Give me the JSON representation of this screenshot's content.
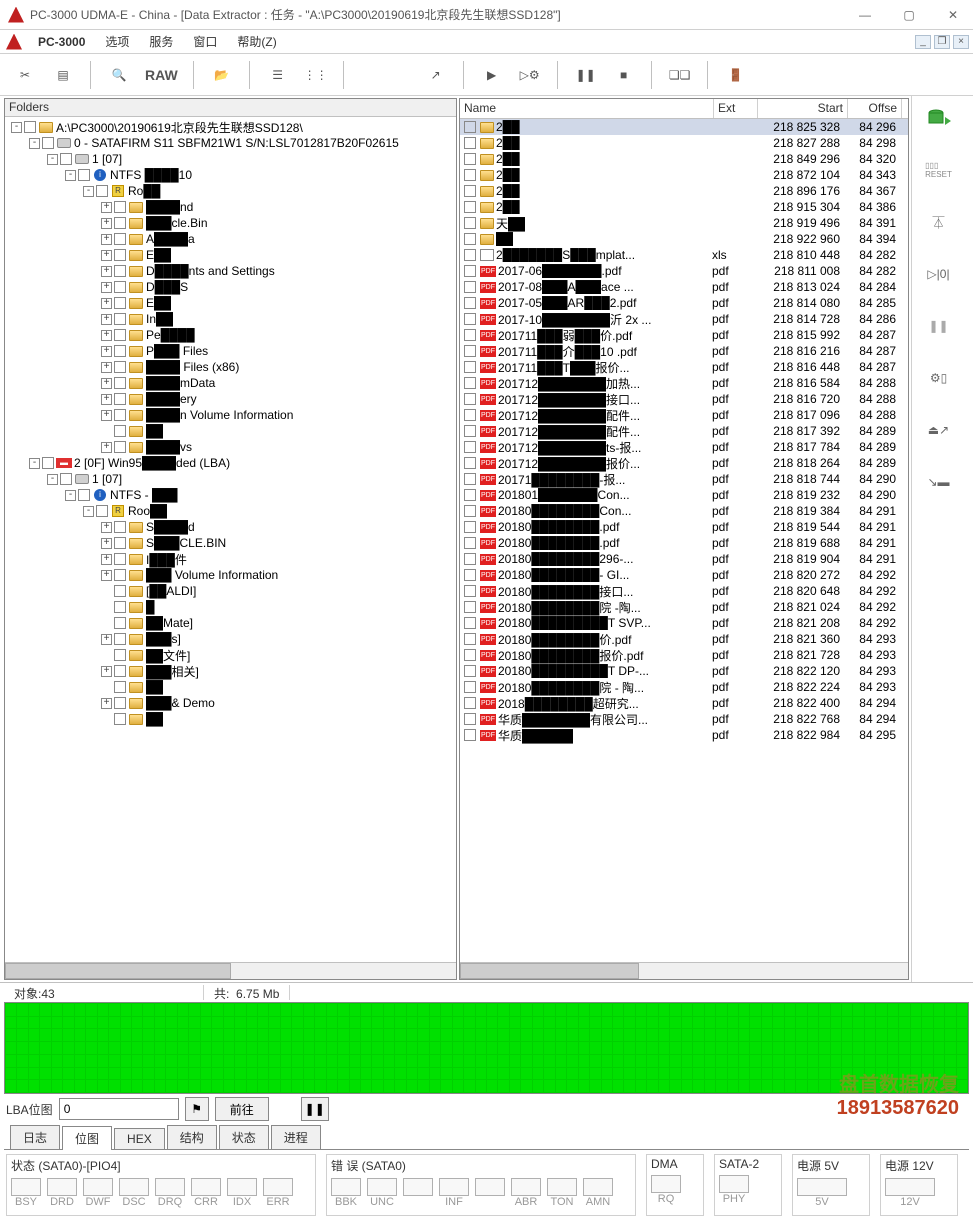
{
  "title": "PC-3000 UDMA-E - China - [Data Extractor : 任务 - \"A:\\PC3000\\20190619北京段先生联想SSD128\"]",
  "menu": {
    "app": "PC-3000",
    "items": [
      "选项",
      "服务",
      "窗口",
      "帮助(Z)"
    ]
  },
  "toolbar": {
    "raw": "RAW"
  },
  "folders_title": "Folders",
  "tree": [
    {
      "indent": 0,
      "exp": "-",
      "cb": true,
      "ico": "folder",
      "label": "A:\\PC3000\\20190619北京段先生联想SSD128\\"
    },
    {
      "indent": 1,
      "exp": "-",
      "cb": true,
      "ico": "disk",
      "label": "0 - SATAFIRM   S11 SBFM21W1 S/N:LSL7012817B20F02615"
    },
    {
      "indent": 2,
      "exp": "-",
      "cb": true,
      "ico": "disk",
      "label": "1 [07]"
    },
    {
      "indent": 3,
      "exp": "-",
      "cb": true,
      "ico": "ntfs",
      "label": "NTFS ████10",
      "blur": true
    },
    {
      "indent": 4,
      "exp": "-",
      "cb": true,
      "ico": "r",
      "label": "Ro██",
      "blur": true
    },
    {
      "indent": 5,
      "exp": "+",
      "cb": true,
      "ico": "folder",
      "label": "████nd",
      "blur": true
    },
    {
      "indent": 5,
      "exp": "+",
      "cb": true,
      "ico": "folder",
      "label": "███cle.Bin",
      "blur": true
    },
    {
      "indent": 5,
      "exp": "+",
      "cb": true,
      "ico": "folder",
      "label": "A████a",
      "blur": true
    },
    {
      "indent": 5,
      "exp": "+",
      "cb": true,
      "ico": "folder",
      "label": "E██",
      "blur": true
    },
    {
      "indent": 5,
      "exp": "+",
      "cb": true,
      "ico": "folder",
      "label": "D████nts and Settings",
      "blur": true
    },
    {
      "indent": 5,
      "exp": "+",
      "cb": true,
      "ico": "folder",
      "label": "D███S",
      "blur": true
    },
    {
      "indent": 5,
      "exp": "+",
      "cb": true,
      "ico": "folder",
      "label": "E██",
      "blur": true
    },
    {
      "indent": 5,
      "exp": "+",
      "cb": true,
      "ico": "folder",
      "label": "In██",
      "blur": true
    },
    {
      "indent": 5,
      "exp": "+",
      "cb": true,
      "ico": "folder",
      "label": "Pe████",
      "blur": true
    },
    {
      "indent": 5,
      "exp": "+",
      "cb": true,
      "ico": "folder",
      "label": "P███ Files",
      "blur": true
    },
    {
      "indent": 5,
      "exp": "+",
      "cb": true,
      "ico": "folder",
      "label": "████ Files (x86)",
      "blur": true
    },
    {
      "indent": 5,
      "exp": "+",
      "cb": true,
      "ico": "folder",
      "label": "████mData",
      "blur": true
    },
    {
      "indent": 5,
      "exp": "+",
      "cb": true,
      "ico": "folder",
      "label": "████ery",
      "blur": true
    },
    {
      "indent": 5,
      "exp": "+",
      "cb": true,
      "ico": "folder",
      "label": "████n Volume Information",
      "blur": true
    },
    {
      "indent": 5,
      "exp": "",
      "cb": true,
      "ico": "folder",
      "label": "██",
      "blur": true
    },
    {
      "indent": 5,
      "exp": "+",
      "cb": true,
      "ico": "folder",
      "label": "████vs",
      "blur": true
    },
    {
      "indent": 1,
      "exp": "-",
      "cb": true,
      "ico": "red",
      "label": "2 [0F] Win95████ded  (LBA)",
      "blur": true
    },
    {
      "indent": 2,
      "exp": "-",
      "cb": true,
      "ico": "disk",
      "label": "1 [07]"
    },
    {
      "indent": 3,
      "exp": "-",
      "cb": true,
      "ico": "ntfs",
      "label": "NTFS - ███",
      "blur": true
    },
    {
      "indent": 4,
      "exp": "-",
      "cb": true,
      "ico": "r",
      "label": "Roo██",
      "blur": true
    },
    {
      "indent": 5,
      "exp": "+",
      "cb": true,
      "ico": "folder",
      "label": "S████d",
      "blur": true
    },
    {
      "indent": 5,
      "exp": "+",
      "cb": true,
      "ico": "folder",
      "label": "S███CLE.BIN",
      "blur": true
    },
    {
      "indent": 5,
      "exp": "+",
      "cb": true,
      "ico": "folder",
      "label": "I███件",
      "blur": true
    },
    {
      "indent": 5,
      "exp": "+",
      "cb": true,
      "ico": "folder",
      "label": "███ Volume Information",
      "blur": true
    },
    {
      "indent": 5,
      "exp": "",
      "cb": true,
      "ico": "folder",
      "label": "[██ALDI]",
      "blur": true
    },
    {
      "indent": 5,
      "exp": "",
      "cb": true,
      "ico": "folder",
      "label": "█",
      "blur": true
    },
    {
      "indent": 5,
      "exp": "",
      "cb": true,
      "ico": "folder",
      "label": "██Mate]",
      "blur": true
    },
    {
      "indent": 5,
      "exp": "+",
      "cb": true,
      "ico": "folder",
      "label": "███s]",
      "blur": true
    },
    {
      "indent": 5,
      "exp": "",
      "cb": true,
      "ico": "folder",
      "label": "██文件]",
      "blur": true
    },
    {
      "indent": 5,
      "exp": "+",
      "cb": true,
      "ico": "folder",
      "label": "███相关]",
      "blur": true
    },
    {
      "indent": 5,
      "exp": "",
      "cb": true,
      "ico": "folder",
      "label": "██",
      "blur": true
    },
    {
      "indent": 5,
      "exp": "+",
      "cb": true,
      "ico": "folder",
      "label": "███& Demo",
      "blur": true
    },
    {
      "indent": 5,
      "exp": "",
      "cb": true,
      "ico": "folder",
      "label": "██",
      "blur": true
    }
  ],
  "file_header": {
    "name": "Name",
    "ext": "Ext",
    "start": "Start",
    "offse": "Offse"
  },
  "files": [
    {
      "ico": "folder",
      "name": "2██",
      "ext": "",
      "start": "218 825 328",
      "offse": "84 296",
      "sel": true
    },
    {
      "ico": "folder",
      "name": "2██",
      "ext": "",
      "start": "218 827 288",
      "offse": "84 298"
    },
    {
      "ico": "folder",
      "name": "2██",
      "ext": "",
      "start": "218 849 296",
      "offse": "84 320"
    },
    {
      "ico": "folder",
      "name": "2██",
      "ext": "",
      "start": "218 872 104",
      "offse": "84 343"
    },
    {
      "ico": "folder",
      "name": "2██",
      "ext": "",
      "start": "218 896 176",
      "offse": "84 367"
    },
    {
      "ico": "folder",
      "name": "2██",
      "ext": "",
      "start": "218 915 304",
      "offse": "84 386"
    },
    {
      "ico": "folder",
      "name": "天██",
      "ext": "",
      "start": "218 919 496",
      "offse": "84 391"
    },
    {
      "ico": "folder",
      "name": "██",
      "ext": "",
      "start": "218 922 960",
      "offse": "84 394"
    },
    {
      "ico": "xls",
      "name": "2███████S███mplat...",
      "ext": "xls",
      "start": "218 810 448",
      "offse": "84 282"
    },
    {
      "ico": "pdf",
      "name": "2017-06███████.pdf",
      "ext": "pdf",
      "start": "218 811 008",
      "offse": "84 282"
    },
    {
      "ico": "pdf",
      "name": "2017-08███A███ace ...",
      "ext": "pdf",
      "start": "218 813 024",
      "offse": "84 284"
    },
    {
      "ico": "pdf",
      "name": "2017-05███AR███2.pdf",
      "ext": "pdf",
      "start": "218 814 080",
      "offse": "84 285"
    },
    {
      "ico": "pdf",
      "name": "2017-10████████沂 2x ...",
      "ext": "pdf",
      "start": "218 814 728",
      "offse": "84 286"
    },
    {
      "ico": "pdf",
      "name": "201711███弱███价.pdf",
      "ext": "pdf",
      "start": "218 815 992",
      "offse": "84 287"
    },
    {
      "ico": "pdf",
      "name": "201711███介███10 .pdf",
      "ext": "pdf",
      "start": "218 816 216",
      "offse": "84 287"
    },
    {
      "ico": "pdf",
      "name": "201711███T███报价...",
      "ext": "pdf",
      "start": "218 816 448",
      "offse": "84 287"
    },
    {
      "ico": "pdf",
      "name": "201712████████加热...",
      "ext": "pdf",
      "start": "218 816 584",
      "offse": "84 288"
    },
    {
      "ico": "pdf",
      "name": "201712████████接口...",
      "ext": "pdf",
      "start": "218 816 720",
      "offse": "84 288"
    },
    {
      "ico": "pdf",
      "name": "201712████████配件...",
      "ext": "pdf",
      "start": "218 817 096",
      "offse": "84 288"
    },
    {
      "ico": "pdf",
      "name": "201712████████配件...",
      "ext": "pdf",
      "start": "218 817 392",
      "offse": "84 289"
    },
    {
      "ico": "pdf",
      "name": "201712████████ts-报...",
      "ext": "pdf",
      "start": "218 817 784",
      "offse": "84 289"
    },
    {
      "ico": "pdf",
      "name": "201712████████报价...",
      "ext": "pdf",
      "start": "218 818 264",
      "offse": "84 289"
    },
    {
      "ico": "pdf",
      "name": "20171████████-报...",
      "ext": "pdf",
      "start": "218 818 744",
      "offse": "84 290"
    },
    {
      "ico": "pdf",
      "name": "201801███████Con...",
      "ext": "pdf",
      "start": "218 819 232",
      "offse": "84 290"
    },
    {
      "ico": "pdf",
      "name": "20180████████Con...",
      "ext": "pdf",
      "start": "218 819 384",
      "offse": "84 291"
    },
    {
      "ico": "pdf",
      "name": "20180████████.pdf",
      "ext": "pdf",
      "start": "218 819 544",
      "offse": "84 291"
    },
    {
      "ico": "pdf",
      "name": "20180████████.pdf",
      "ext": "pdf",
      "start": "218 819 688",
      "offse": "84 291"
    },
    {
      "ico": "pdf",
      "name": "20180████████296-...",
      "ext": "pdf",
      "start": "218 819 904",
      "offse": "84 291"
    },
    {
      "ico": "pdf",
      "name": "20180████████- GI...",
      "ext": "pdf",
      "start": "218 820 272",
      "offse": "84 292"
    },
    {
      "ico": "pdf",
      "name": "20180████████接口...",
      "ext": "pdf",
      "start": "218 820 648",
      "offse": "84 292"
    },
    {
      "ico": "pdf",
      "name": "20180████████院 -陶...",
      "ext": "pdf",
      "start": "218 821 024",
      "offse": "84 292"
    },
    {
      "ico": "pdf",
      "name": "20180█████████T SVP...",
      "ext": "pdf",
      "start": "218 821 208",
      "offse": "84 292"
    },
    {
      "ico": "pdf",
      "name": "20180████████价.pdf",
      "ext": "pdf",
      "start": "218 821 360",
      "offse": "84 293"
    },
    {
      "ico": "pdf",
      "name": "20180████████报价.pdf",
      "ext": "pdf",
      "start": "218 821 728",
      "offse": "84 293"
    },
    {
      "ico": "pdf",
      "name": "20180█████████T DP-...",
      "ext": "pdf",
      "start": "218 822 120",
      "offse": "84 293"
    },
    {
      "ico": "pdf",
      "name": "20180████████院 - 陶...",
      "ext": "pdf",
      "start": "218 822 224",
      "offse": "84 293"
    },
    {
      "ico": "pdf",
      "name": "2018████████超研究...",
      "ext": "pdf",
      "start": "218 822 400",
      "offse": "84 294"
    },
    {
      "ico": "pdf",
      "name": "华质████████有限公司...",
      "ext": "pdf",
      "start": "218 822 768",
      "offse": "84 294"
    },
    {
      "ico": "pdf",
      "name": "华质██████",
      "ext": "pdf",
      "start": "218 822 984",
      "offse": "84 295"
    }
  ],
  "status": {
    "objects_label": "对象:",
    "objects": "43",
    "total_label": "共:",
    "total": "6.75 Mb"
  },
  "lba": {
    "label": "LBA位图",
    "value": "0",
    "go": "前往"
  },
  "tabs": [
    "日志",
    "位图",
    "HEX",
    "结构",
    "状态",
    "进程"
  ],
  "active_tab": 1,
  "bottom": {
    "status_title": "状态 (SATA0)-[PIO4]",
    "status_leds": [
      "BSY",
      "DRD",
      "DWF",
      "DSC",
      "DRQ",
      "CRR",
      "IDX",
      "ERR"
    ],
    "error_title": "错 误 (SATA0)",
    "error_leds": [
      "BBK",
      "UNC",
      "",
      "INF",
      "",
      "ABR",
      "TON",
      "AMN"
    ],
    "dma": {
      "title": "DMA",
      "led": "RQ"
    },
    "sata2": {
      "title": "SATA-2",
      "led": "PHY"
    },
    "p5v": {
      "title": "电源 5V",
      "led": "5V"
    },
    "p12v": {
      "title": "电源 12V",
      "led": "12V"
    }
  },
  "watermark": {
    "l1": "盘首数据恢复",
    "l2": "18913587620"
  }
}
